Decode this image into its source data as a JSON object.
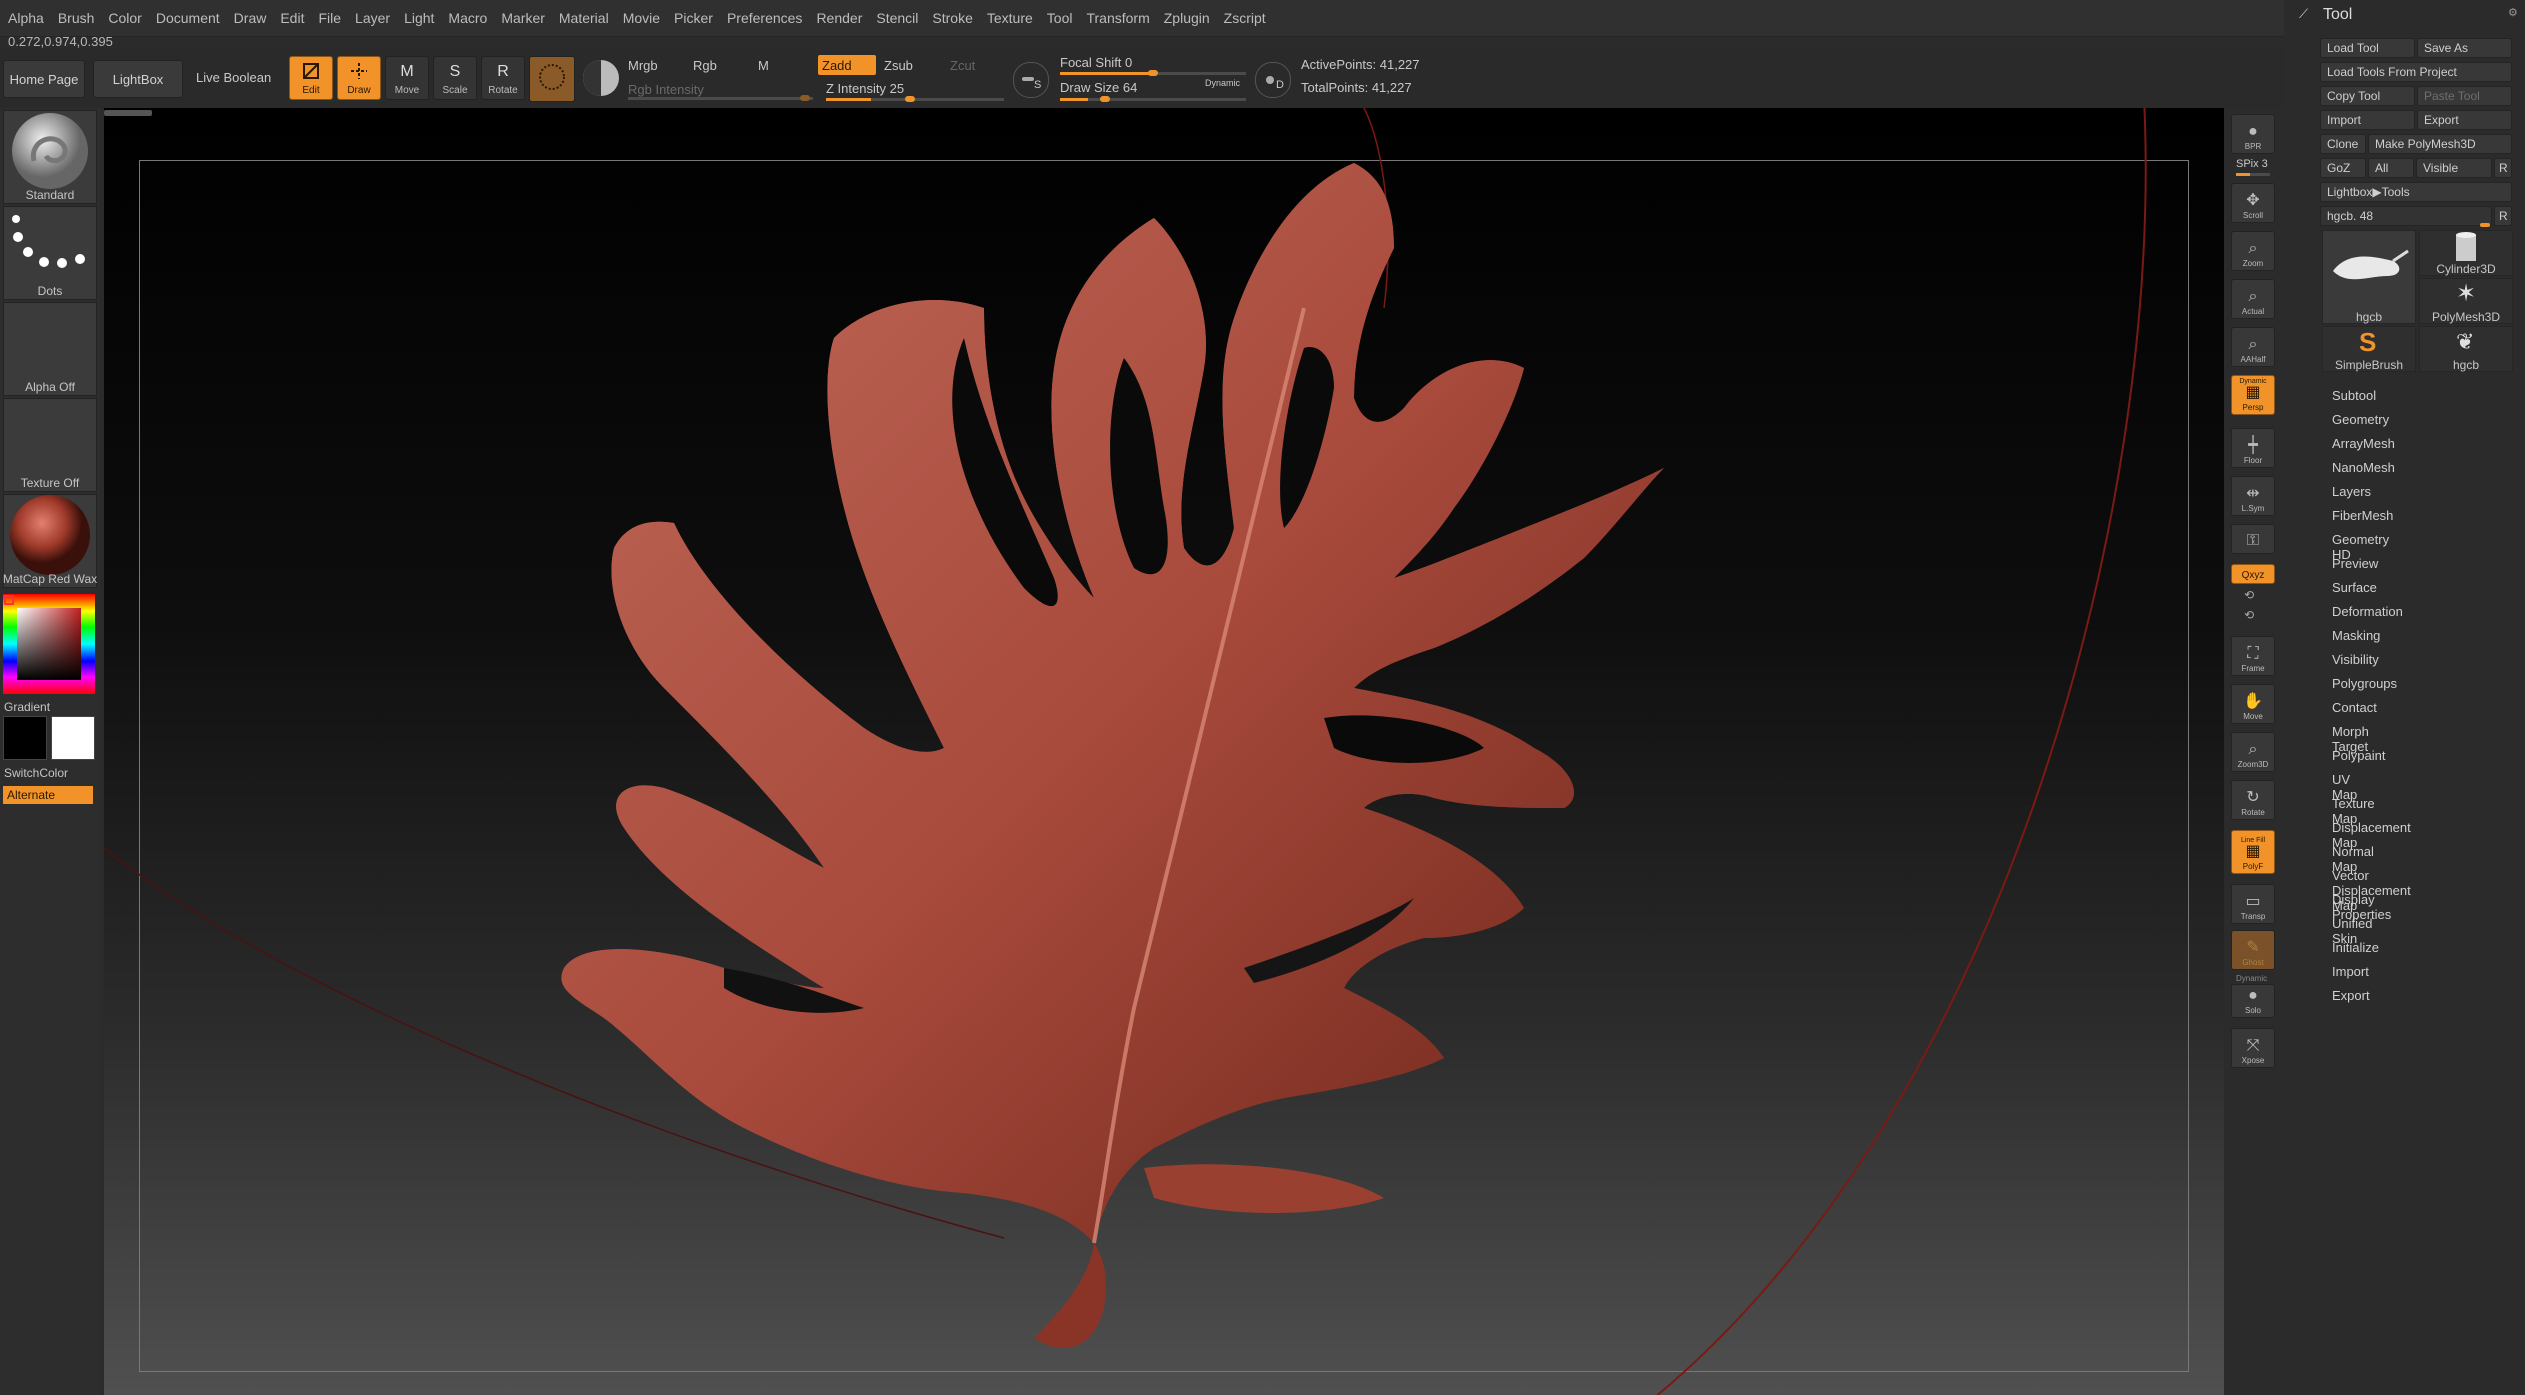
{
  "menu": [
    "Alpha",
    "Brush",
    "Color",
    "Document",
    "Draw",
    "Edit",
    "File",
    "Layer",
    "Light",
    "Macro",
    "Marker",
    "Material",
    "Movie",
    "Picker",
    "Preferences",
    "Render",
    "Stencil",
    "Stroke",
    "Texture",
    "Tool",
    "Transform",
    "Zplugin",
    "Zscript"
  ],
  "coords": "0.272,0.974,0.395",
  "toolbar": {
    "home_page": "Home Page",
    "lightbox": "LightBox",
    "live_boolean": "Live Boolean",
    "edit": "Edit",
    "draw": "Draw",
    "move": "Move",
    "scale": "Scale",
    "rotate": "Rotate",
    "mrgb": "Mrgb",
    "rgb": "Rgb",
    "m": "M",
    "rgb_intensity": "Rgb Intensity",
    "zadd": "Zadd",
    "zsub": "Zsub",
    "zcut": "Zcut",
    "z_intensity_label": "Z Intensity",
    "z_intensity_value": "25",
    "focal_shift_label": "Focal Shift",
    "focal_shift_value": "0",
    "draw_size_label": "Draw Size",
    "draw_size_value": "64",
    "dynamic": "Dynamic",
    "active_points": "ActivePoints: 41,227",
    "total_points": "TotalPoints: 41,227",
    "s_key": "S",
    "d_key": "D"
  },
  "left_tray": {
    "brush": "Standard",
    "stroke": "Dots",
    "alpha": "Alpha Off",
    "texture": "Texture Off",
    "material": "MatCap Red Wax",
    "gradient": "Gradient",
    "switch_color": "SwitchColor",
    "alternate": "Alternate"
  },
  "right_shelf": {
    "bpr": "BPR",
    "spix": "SPix 3",
    "scroll": "Scroll",
    "zoom": "Zoom",
    "actual": "Actual",
    "aahalf": "AAHalf",
    "dynamic": "Dynamic",
    "persp": "Persp",
    "floor": "Floor",
    "lsym": "L.Sym",
    "xyz": "Qxyz",
    "frame": "Frame",
    "move": "Move",
    "zoom3d": "Zoom3D",
    "rotate": "Rotate",
    "line_fill": "Line Fill",
    "polyf": "PolyF",
    "transp": "Transp",
    "ghost": "Ghost",
    "solo": "Solo",
    "xpose": "Xpose"
  },
  "tool_panel": {
    "title": "Tool",
    "load_tool": "Load Tool",
    "save_as": "Save As",
    "load_from_project": "Load Tools From Project",
    "copy_tool": "Copy Tool",
    "paste_tool": "Paste Tool",
    "import": "Import",
    "export": "Export",
    "clone": "Clone",
    "make_polymesh": "Make PolyMesh3D",
    "goz": "GoZ",
    "all": "All",
    "visible": "Visible",
    "r": "R",
    "lightbox_tools": "Lightbox▶Tools",
    "current_tool": "hgcb. 48",
    "r2": "R",
    "thumbs": [
      "hgcb",
      "Cylinder3D",
      "PolyMesh3D",
      "SimpleBrush",
      "hgcb"
    ],
    "sections": [
      "Subtool",
      "Geometry",
      "ArrayMesh",
      "NanoMesh",
      "Layers",
      "FiberMesh",
      "Geometry HD",
      "Preview",
      "Surface",
      "Deformation",
      "Masking",
      "Visibility",
      "Polygroups",
      "Contact",
      "Morph Target",
      "Polypaint",
      "UV Map",
      "Texture Map",
      "Displacement Map",
      "Normal Map",
      "Vector Displacement Map",
      "Display Properties",
      "Unified Skin",
      "Initialize",
      "Import",
      "Export"
    ]
  },
  "colors": {
    "accent": "#f2932a",
    "leaf": "#a84a3c",
    "leaf_wire": "#3a1410",
    "bg": "#2b2b2b"
  }
}
